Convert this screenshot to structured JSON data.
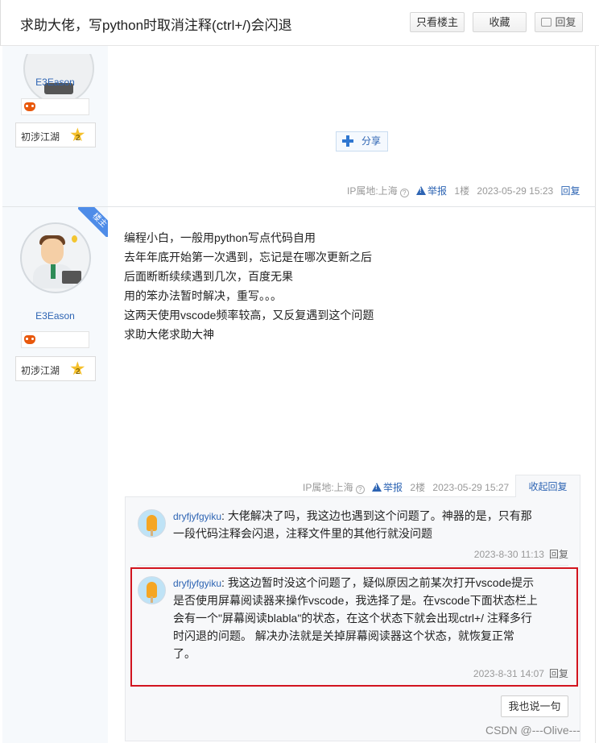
{
  "header": {
    "title": "求助大佬，写python时取消注释(ctrl+/)会闪退",
    "only_op": "只看楼主",
    "favorite": "收藏",
    "reply": "回复"
  },
  "post1": {
    "username": "E3Eason",
    "level_name": "初涉江湖",
    "level_num": "2",
    "share_label": "分享",
    "ip": "IP属地:上海",
    "report": "举报",
    "floor": "1楼",
    "datetime": "2023-05-29 15:23",
    "reply": "回复"
  },
  "post2": {
    "corner": "楼主",
    "username": "E3Eason",
    "level_name": "初涉江湖",
    "level_num": "2",
    "lines": [
      "编程小白，一般用python写点代码自用",
      "去年年底开始第一次遇到，忘记是在哪次更新之后",
      "后面断断续续遇到几次，百度无果",
      "用的笨办法暂时解决，重写。。。",
      "这两天使用vscode频率较高，又反复遇到这个问题",
      "求助大佬求助大神"
    ],
    "ip": "IP属地:上海",
    "report": "举报",
    "floor": "2楼",
    "datetime": "2023-05-29 15:27",
    "collapse_reply": "收起回复"
  },
  "replies": [
    {
      "user": "dryfjyfgyiku",
      "lines": [
        "大佬解决了吗，我这边也遇到这个问题了。神器的是，只有那",
        "一段代码注释会闪退，注释文件里的其他行就没问题"
      ],
      "datetime": "2023-8-30 11:13",
      "reply": "回复"
    },
    {
      "user": "dryfjyfgyiku",
      "lines": [
        "我这边暂时没这个问题了，疑似原因之前某次打开vscode提示",
        "是否使用屏幕阅读器来操作vscode，我选择了是。在vscode下面状态栏上",
        "会有一个\"屏幕阅读blabla\"的状态，在这个状态下就会出现ctrl+/ 注释多行",
        "时闪退的问题。 解决办法就是关掉屏幕阅读器这个状态，就恢复正常",
        "了。"
      ],
      "datetime": "2023-8-31 14:07",
      "reply": "回复"
    }
  ],
  "say_button": "我也说一句",
  "watermark": "CSDN @---Olive---",
  "colors": {
    "link": "#2d64b3",
    "highlight_border": "#d2141e",
    "sidebar": "#f6f9fc"
  }
}
